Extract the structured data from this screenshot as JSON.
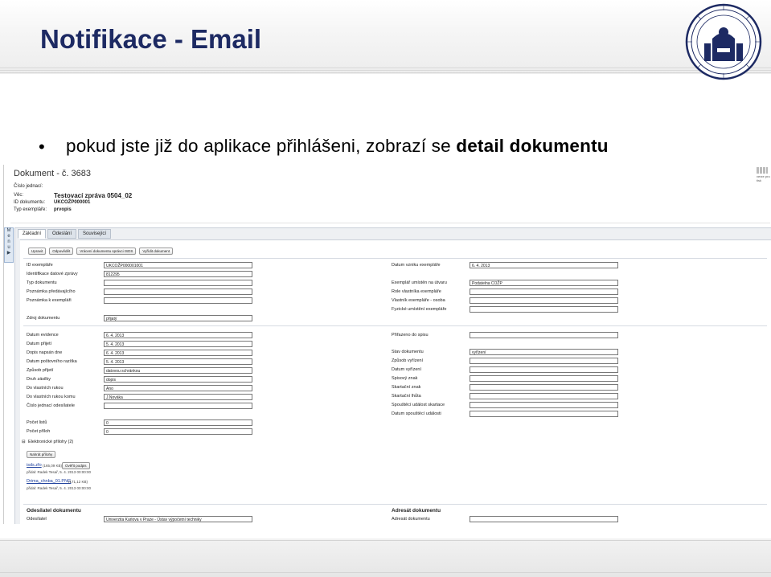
{
  "slide": {
    "title": "Notifikace - Email",
    "bullet_prefix": "pokud jste již do aplikace přihlášeni, zobrazí se ",
    "bullet_bold": "detail dokumentu"
  },
  "app": {
    "doc_title": "Dokument - č. 3683",
    "print_label": "verze pro tisk",
    "header": {
      "cislo_label": "Číslo jednací:",
      "vec_label": "Věc:",
      "vec_value": "Testovací zpráva 0504_02",
      "id_label": "ID dokumentu:",
      "id_value": "UKCOŽP000001",
      "typ_label": "Typ exempláře:",
      "typ_value": "prvopis"
    },
    "menu_tab": [
      "M",
      "e",
      "n",
      "u",
      "▶"
    ],
    "tabs": [
      "Základní",
      "Odeslání",
      "Související"
    ],
    "buttons": [
      "Upravit",
      "Odpovědět",
      "Vrácení dokumentu správci ISDS",
      "Vyřídit dokument"
    ],
    "section1_left": [
      {
        "label": "ID exempláře",
        "value": "UKCOŽP000001001"
      },
      {
        "label": "Identifikace datové zprávy",
        "value": "812295"
      },
      {
        "label": "Typ dokumentu",
        "value": ""
      },
      {
        "label": "Poznámka předávajícího",
        "value": ""
      },
      {
        "label": "Poznámka k exempláři",
        "value": ""
      }
    ],
    "section1_right": [
      {
        "label": "Datum vzniku exempláře",
        "value": "6. 4. 2013"
      },
      {
        "label": "Exemplář umístěn na útvaru",
        "value": "Podatelna COŽP"
      },
      {
        "label": "Role vlastníka exempláře",
        "value": ""
      },
      {
        "label": "Vlastník exempláře - osoba",
        "value": ""
      },
      {
        "label": "Fyzické umístění exempláře",
        "value": ""
      }
    ],
    "zdroj": {
      "label": "Zdroj dokumentu",
      "value": "přijatý"
    },
    "section2_left": [
      {
        "label": "Datum evidence",
        "value": "6. 4. 2013"
      },
      {
        "label": "Datum přijetí",
        "value": "5. 4. 2013"
      },
      {
        "label": "Dopis napsán dne",
        "value": "6. 4. 2013"
      },
      {
        "label": "Datum poštovního razítka",
        "value": "5. 4. 2013"
      },
      {
        "label": "Způsob přijetí",
        "value": "datovou schránkou"
      },
      {
        "label": "Druh zásilky",
        "value": "dopis"
      },
      {
        "label": "Do vlastních rukou",
        "value": "Ano"
      },
      {
        "label": "Do vlastních rukou komu",
        "value": "J.Nováka"
      },
      {
        "label": "Číslo jednací odesílatele",
        "value": ""
      }
    ],
    "section2_right": [
      {
        "label": "Přiřazeno do spisu",
        "value": ""
      },
      {
        "label": "Stav dokumentu",
        "value": "vyřízení"
      },
      {
        "label": "Způsob vyřízení",
        "value": ""
      },
      {
        "label": "Datum vyřízení",
        "value": ""
      },
      {
        "label": "Spisový znak",
        "value": ""
      },
      {
        "label": "Skartační znak",
        "value": ""
      },
      {
        "label": "Skartační lhůta",
        "value": ""
      },
      {
        "label": "Spouštěcí událost skartace",
        "value": ""
      },
      {
        "label": "Datum spouštěcí události",
        "value": ""
      }
    ],
    "counts": [
      {
        "label": "Počet listů",
        "value": "0"
      },
      {
        "label": "Počet příloh",
        "value": "0"
      }
    ],
    "attachments": {
      "header": "Elektronické přílohy (2)",
      "add_button": "Nahrát přílohy",
      "items": [
        {
          "name": "isds.zfo",
          "size": "(165,09 KB)",
          "action": "Ověřit podpis",
          "meta": "přidal: Radek Tesař, 5. 4. 2013 00:00:00"
        },
        {
          "name": "Drima_chnba_01.PNG",
          "size": "(171,12 KB)",
          "action": "",
          "meta": "přidal: Radek Tesař, 5. 4. 2013 00:00:00"
        }
      ]
    },
    "sender": {
      "header": "Odesílatel dokumentu",
      "label": "Odesílatel",
      "value": "Univerzita Karlova v Praze - Ústav výpočetní techniky"
    },
    "recipient": {
      "header": "Adresát dokumentu",
      "label": "Adresát dokumentu",
      "value": ""
    }
  }
}
